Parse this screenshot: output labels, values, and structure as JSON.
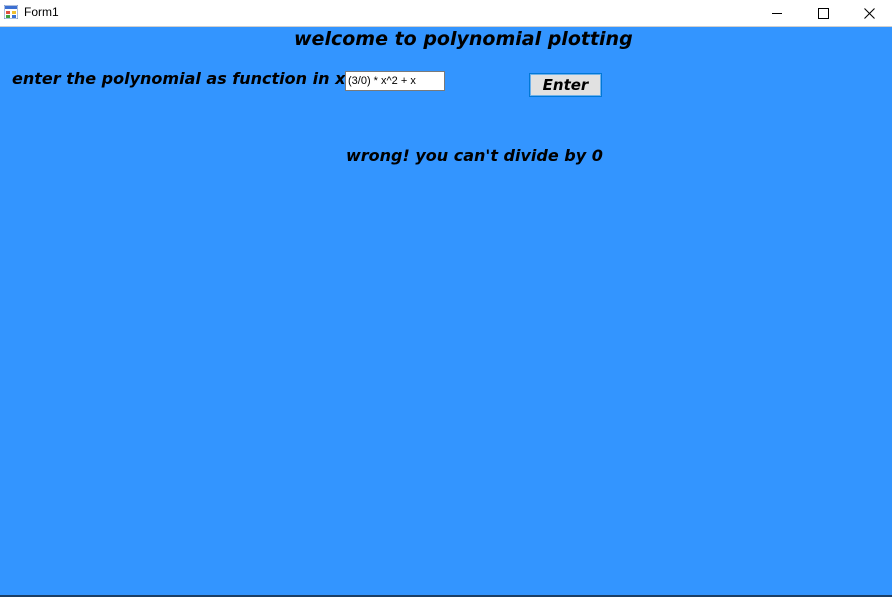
{
  "window": {
    "title": "Form1",
    "icon": "winforms-app-icon",
    "controls": [
      "minimize-icon",
      "maximize-icon",
      "close-icon"
    ]
  },
  "form": {
    "heading": "welcome to polynomial plotting",
    "prompt": "enter the polynomial as function in x",
    "polynomial_value": "(3/0) * x^2 + x",
    "enter_label": "Enter",
    "error_message": "wrong! you can't divide by 0"
  },
  "colors": {
    "background": "#3395ff",
    "titlebar": "#ffffff",
    "button": "#e1e1e1",
    "button_border": "#0078d7"
  }
}
